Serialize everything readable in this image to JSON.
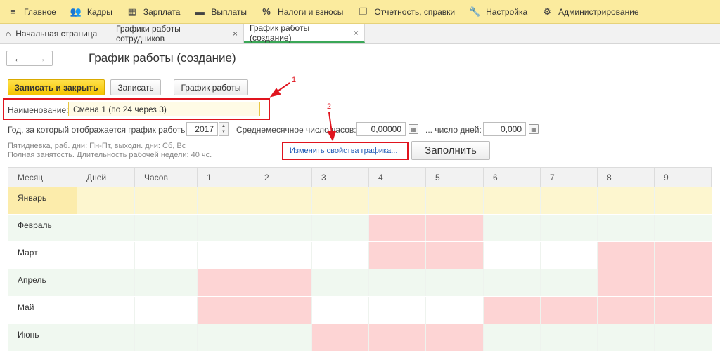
{
  "menu": [
    {
      "icon": "menu-icon",
      "glyph": "≡",
      "label": "Главное"
    },
    {
      "icon": "people-icon",
      "glyph": "👥",
      "label": "Кадры"
    },
    {
      "icon": "calculator-icon",
      "glyph": "▦",
      "label": "Зарплата"
    },
    {
      "icon": "payments-icon",
      "glyph": "▬",
      "label": "Выплаты"
    },
    {
      "icon": "percent-icon",
      "glyph": "%",
      "label": "Налоги и взносы"
    },
    {
      "icon": "reports-icon",
      "glyph": "❐",
      "label": "Отчетность, справки"
    },
    {
      "icon": "wrench-icon",
      "glyph": "🔧",
      "label": "Настройка"
    },
    {
      "icon": "gear-icon",
      "glyph": "⚙",
      "label": "Администрирование"
    }
  ],
  "tabs": {
    "home": "Начальная страница",
    "tab1": "Графики работы сотрудников",
    "tab2": "График работы (создание)",
    "close_glyph": "×"
  },
  "header": {
    "back": "←",
    "forward": "→",
    "title": "График работы (создание)"
  },
  "toolbar": {
    "save_close": "Записать и закрыть",
    "save": "Записать",
    "schedule": "График работы"
  },
  "form": {
    "name_label": "Наименование:",
    "name_value": "Смена 1 (по 24 через 3)",
    "year_label": "Год, за который отображается график работы:",
    "year_value": "2017",
    "avg_hours_label": "Среднемесячное число часов:",
    "avg_hours_value": "0,00000",
    "days_label": "... число дней:",
    "days_value": "0,000",
    "hint_line1": "Пятидневка, раб. дни: Пн-Пт, выходн. дни: Сб, Вс",
    "hint_line2": "Полная занятость. Длительность рабочей недели: 40 чс.",
    "change_link": "Изменить свойства графика...",
    "fill_button": "Заполнить"
  },
  "annotations": {
    "one": "1",
    "two": "2"
  },
  "grid": {
    "headers": [
      "Месяц",
      "Дней",
      "Часов",
      "1",
      "2",
      "3",
      "4",
      "5",
      "6",
      "7",
      "8",
      "9"
    ],
    "rows": [
      {
        "month": "Январь",
        "off": []
      },
      {
        "month": "Февраль",
        "off": [
          4,
          5
        ]
      },
      {
        "month": "Март",
        "off": [
          4,
          5,
          8,
          9
        ]
      },
      {
        "month": "Апрель",
        "off": [
          1,
          2,
          8,
          9
        ]
      },
      {
        "month": "Май",
        "off": [
          1,
          2,
          6,
          7,
          8,
          9
        ]
      },
      {
        "month": "Июнь",
        "off": [
          3,
          4,
          5
        ]
      }
    ]
  }
}
